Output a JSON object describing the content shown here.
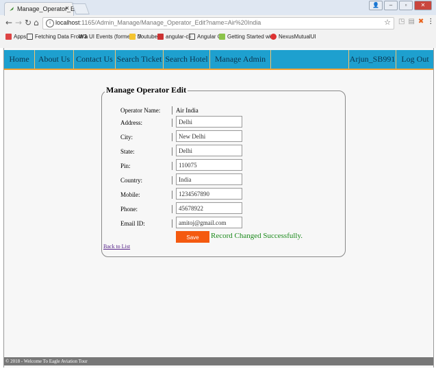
{
  "browser": {
    "tab_title": "Manage_Operator_Edit -",
    "tab_close": "×",
    "url_host": "localhost",
    "url_rest": ":1165/Admin_Manage/Manage_Operator_Edit?name=Air%20India",
    "bookmarks": [
      "Apps",
      "Fetching Data From a",
      "UI Events (formerly D",
      "Youtube",
      "angular-cli",
      "Angular Cli",
      "Getting Started with",
      "NexusMutualUI"
    ]
  },
  "menu": {
    "home": "Home",
    "about": "About Us",
    "contact": "Contact Us",
    "search_ticket": "Search Ticket",
    "search_hotel": "Search Hotel",
    "manage_admin": "Manage Admin",
    "user": "Arjun_SB991",
    "logout": "Log Out"
  },
  "form": {
    "legend": "Manage Operator Edit",
    "operator_name_label": "Operator Name:",
    "operator_name_value": "Air India",
    "address_label": "Address:",
    "address_value": "Delhi",
    "city_label": "City:",
    "city_value": "New Delhi",
    "state_label": "State:",
    "state_value": "Delhi",
    "pin_label": "Pin:",
    "pin_value": "110075",
    "country_label": "Country:",
    "country_value": "India",
    "mobile_label": "Mobile:",
    "mobile_value": "1234567890",
    "phone_label": "Phone:",
    "phone_value": "45678922",
    "email_label": "Email ID:",
    "email_value": "amitoj@gmail.com",
    "save_label": "Save",
    "status_message": "Record Changed Successfully.",
    "back_link": "Back to List"
  },
  "footer": {
    "text": "© 2018 - Welcome To Eagle Aviation Tour"
  },
  "colors": {
    "menubar": "#1ea0cf",
    "save_button": "#f45a10",
    "success": "#1b8a1b"
  }
}
